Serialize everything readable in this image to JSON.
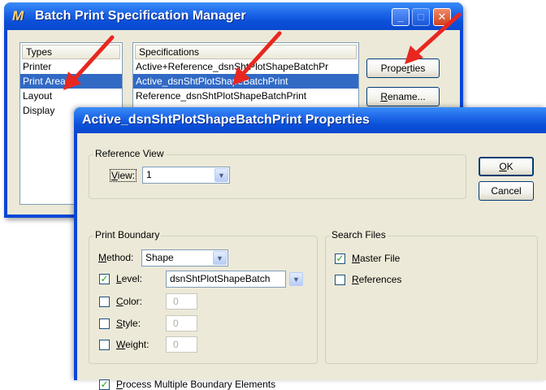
{
  "back_window": {
    "title": "Batch Print Specification Manager",
    "app_icon_glyph": "M",
    "caption_buttons": {
      "minimize": "_",
      "maximize": "□",
      "close": "✕"
    },
    "types": {
      "header": "Types",
      "items": [
        "Printer",
        "Print Area",
        "Layout",
        "Display"
      ],
      "selected_index": 1
    },
    "specifications": {
      "header": "Specifications",
      "items": [
        "Active+Reference_dsnShtPlotShapeBatchPr",
        "Active_dsnShtPlotShapeBatchPrint",
        "Reference_dsnShtPlotShapeBatchPrint"
      ],
      "selected_index": 1
    },
    "buttons": {
      "properties": {
        "pre": "Prope",
        "key": "r",
        "post": "ties"
      },
      "rename": {
        "pre": "",
        "key": "R",
        "post": "ename..."
      }
    }
  },
  "dialog": {
    "title": "Active_dsnShtPlotShapeBatchPrint Properties",
    "ok": {
      "key": "O",
      "post": "K"
    },
    "cancel": "Cancel",
    "reference_view": {
      "label": "Reference View",
      "view_label": {
        "key": "V",
        "post": "iew:"
      },
      "view_value": "1"
    },
    "print_boundary": {
      "label": "Print Boundary",
      "method_label": {
        "pre": "",
        "key": "M",
        "post": "ethod:"
      },
      "method_value": "Shape",
      "level": {
        "key": "L",
        "post": "evel:",
        "checked": true,
        "value": "dsnShtPlotShapeBatch"
      },
      "color": {
        "key": "C",
        "post": "olor:",
        "checked": false,
        "value": "0"
      },
      "style": {
        "key": "S",
        "post": "tyle:",
        "checked": false,
        "value": "0"
      },
      "weight": {
        "key": "W",
        "post": "eight:",
        "checked": false,
        "value": "0"
      }
    },
    "search_files": {
      "label": "Search Files",
      "master_file": {
        "key": "M",
        "post": "aster File",
        "checked": true
      },
      "references": {
        "key": "R",
        "post": "eferences",
        "checked": false
      }
    },
    "process_multiple": {
      "key": "P",
      "post": "rocess Multiple Boundary Elements",
      "checked": true
    }
  },
  "check_glyph": "✓",
  "dropdown_glyph": "▼",
  "colors": {
    "titlebar": "#0a47d6",
    "selection": "#316ac5",
    "dialog_face": "#ece9d8",
    "annotation_arrow": "#e8271f"
  },
  "icons": [
    "app-icon",
    "minimize-icon",
    "maximize-icon",
    "close-icon",
    "chevron-down-icon",
    "checkmark-icon",
    "red-annotation-arrow"
  ]
}
